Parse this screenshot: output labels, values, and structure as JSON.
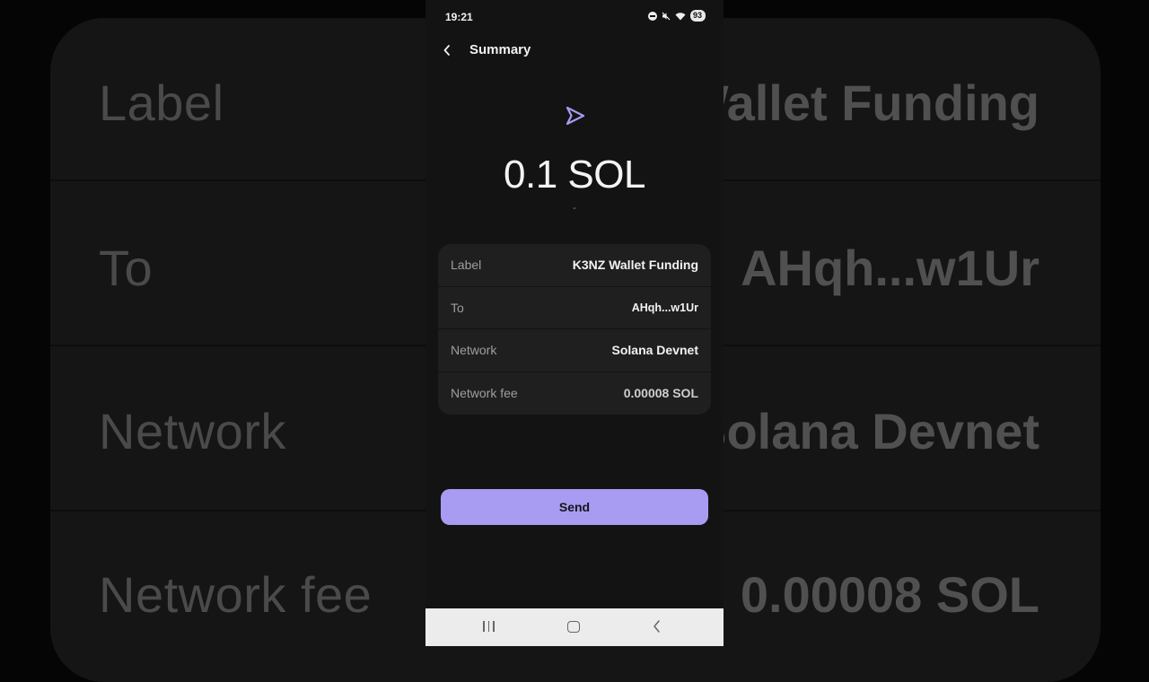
{
  "status_bar": {
    "time": "19:21",
    "battery": "93",
    "icons": [
      "dnd-icon",
      "mute-icon",
      "wifi-icon",
      "battery-icon"
    ]
  },
  "header": {
    "title": "Summary",
    "back_icon": "chevron-left-icon"
  },
  "transaction": {
    "icon": "send-arrow-icon",
    "amount": "0.1 SOL",
    "fiat": "-"
  },
  "details": [
    {
      "label": "Label",
      "value": "K3NZ Wallet Funding"
    },
    {
      "label": "To",
      "value": "AHqh...w1Ur"
    },
    {
      "label": "Network",
      "value": "Solana Devnet"
    },
    {
      "label": "Network fee",
      "value": "0.00008 SOL"
    }
  ],
  "actions": {
    "send_label": "Send"
  },
  "colors": {
    "accent": "#a89bf2",
    "background": "#131313",
    "card": "#1f1f1f"
  },
  "nav_bar": {
    "icons": [
      "recents-icon",
      "home-icon",
      "back-icon"
    ]
  }
}
